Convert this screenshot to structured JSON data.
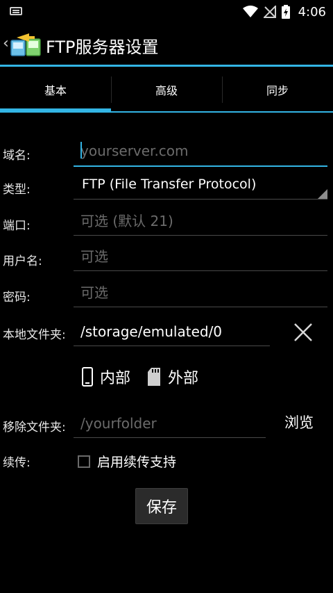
{
  "status_bar": {
    "time": "4:06"
  },
  "action_bar": {
    "title": "FTP服务器设置"
  },
  "tabs": [
    {
      "label": "基本",
      "active": true
    },
    {
      "label": "高级",
      "active": false
    },
    {
      "label": "同步",
      "active": false
    }
  ],
  "form": {
    "domain": {
      "label": "域名:",
      "value": "",
      "placeholder": "yourserver.com"
    },
    "type": {
      "label": "类型:",
      "value": "FTP (File Transfer Protocol)"
    },
    "port": {
      "label": "端口:",
      "value": "",
      "placeholder": "可选 (默认 21)"
    },
    "username": {
      "label": "用户名:",
      "value": "",
      "placeholder": "可选"
    },
    "password": {
      "label": "密码:",
      "value": "",
      "placeholder": "可选"
    },
    "local_folder": {
      "label": "本地文件夹:",
      "value": "/storage/emulated/0"
    },
    "storage_options": {
      "internal": "内部",
      "external": "外部"
    },
    "remote_folder": {
      "label": "移除文件夹:",
      "value": "",
      "placeholder": "/yourfolder"
    },
    "browse_label": "浏览",
    "resume": {
      "label": "续传:",
      "checkbox_label": "启用续传支持",
      "checked": false
    },
    "save_label": "保存"
  },
  "colors": {
    "accent": "#33b5e5",
    "background": "#000000"
  }
}
